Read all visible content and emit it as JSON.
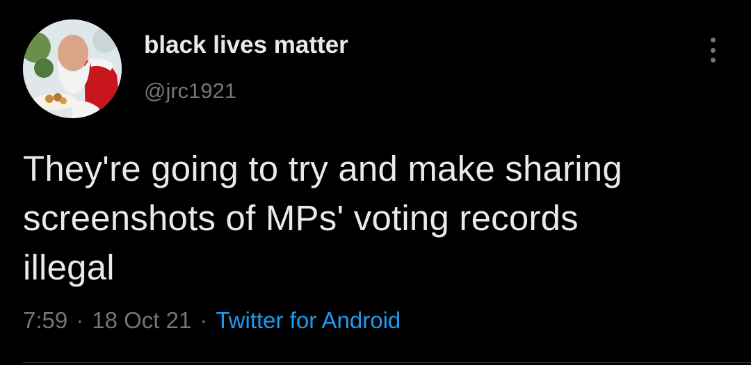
{
  "tweet": {
    "author": {
      "display_name": "black lives matter",
      "handle": "@jrc1921",
      "avatar_icon": "profile-photo"
    },
    "text_lines": [
      "They're going to try and make sharing",
      "screenshots of MPs' voting records",
      "illegal"
    ],
    "meta": {
      "time": "7:59",
      "separator": "·",
      "date": "18 Oct 21",
      "source": "Twitter for Android"
    },
    "more_icon": "more-vertical-icon"
  },
  "colors": {
    "background": "#000000",
    "primary_text": "#e7e9ea",
    "secondary_text": "#71767b",
    "link": "#1d9bf0",
    "divider": "#2f3336"
  }
}
